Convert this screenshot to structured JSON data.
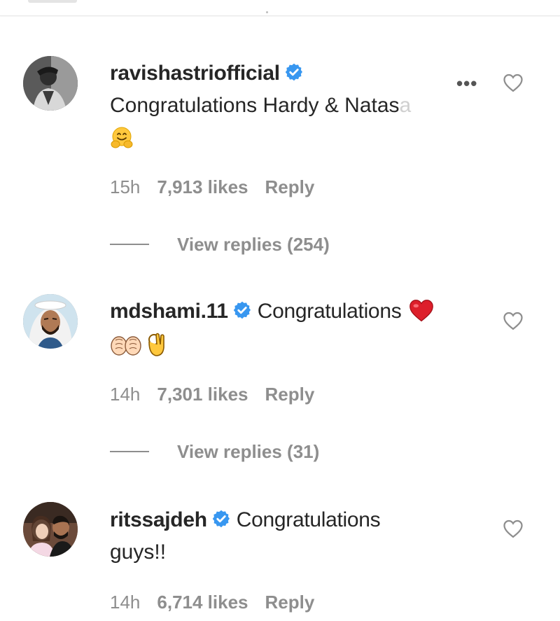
{
  "comments": [
    {
      "username": "ravishastriofficial",
      "verified": true,
      "text": "Congratulations Hardy & Natas",
      "text_fade": "a",
      "emojis": [
        "hugging-face"
      ],
      "time": "15h",
      "likes": "7,913 likes",
      "reply_label": "Reply",
      "view_replies": "View replies (254)",
      "has_more_menu": true
    },
    {
      "username": "mdshami.11",
      "verified": true,
      "text": "Congratulations",
      "emojis": [
        "red-heart",
        "folded-hands",
        "ok-hand"
      ],
      "time": "14h",
      "likes": "7,301 likes",
      "reply_label": "Reply",
      "view_replies": "View replies (31)"
    },
    {
      "username": "ritssajdeh",
      "verified": true,
      "text": "Congratulations",
      "text_line2": "guys!!",
      "time": "14h",
      "likes": "6,714 likes",
      "reply_label": "Reply"
    }
  ],
  "more_menu": "•••",
  "colors": {
    "text": "#262626",
    "meta": "#8e8e8e",
    "verified": "#3897f0",
    "heart_outline": "#8e8e8e"
  }
}
